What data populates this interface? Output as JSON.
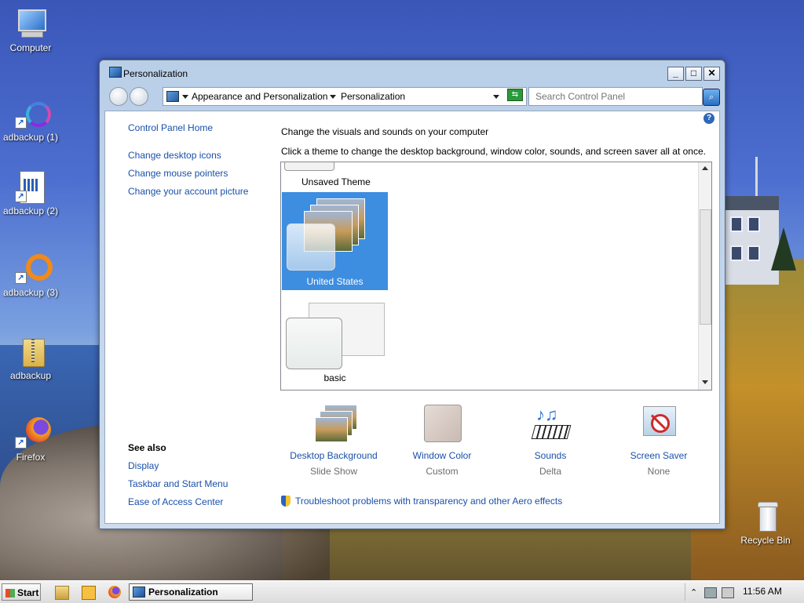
{
  "desktop": {
    "icons": [
      {
        "label": "Computer"
      },
      {
        "label": "adbackup (1)"
      },
      {
        "label": "adbackup (2)"
      },
      {
        "label": "adbackup (3)"
      },
      {
        "label": "adbackup"
      },
      {
        "label": "Firefox"
      },
      {
        "label": "Recycle Bin"
      }
    ]
  },
  "window": {
    "title": "Personalization",
    "buttons": {
      "minimize": "_",
      "maximize": "□",
      "close": "✕"
    },
    "breadcrumb": [
      "Appearance and Personalization",
      "Personalization"
    ],
    "search_placeholder": "Search Control Panel"
  },
  "sidebar": {
    "home": "Control Panel Home",
    "links": [
      "Change desktop icons",
      "Change mouse pointers",
      "Change your account picture"
    ],
    "see_also_title": "See also",
    "see_also": [
      "Display",
      "Taskbar and Start Menu",
      "Ease of Access Center"
    ]
  },
  "main": {
    "heading": "Change the visuals and sounds on your computer",
    "subheading": "Click a theme to change the desktop background, window color, sounds, and screen saver all at once.",
    "themes": [
      {
        "label": "Unsaved Theme"
      },
      {
        "label": "United States",
        "selected": true
      },
      {
        "label": "basic"
      }
    ],
    "settings": [
      {
        "name": "Desktop Background",
        "value": "Slide Show"
      },
      {
        "name": "Window Color",
        "value": "Custom"
      },
      {
        "name": "Sounds",
        "value": "Delta"
      },
      {
        "name": "Screen Saver",
        "value": "None"
      }
    ],
    "troubleshoot": "Troubleshoot problems with transparency and other Aero effects"
  },
  "taskbar": {
    "start_label": "Start",
    "active_task": "Personalization",
    "clock": "11:56 AM"
  },
  "colors": {
    "link": "#1a50a8",
    "selected_theme": "#3d8ee0"
  }
}
